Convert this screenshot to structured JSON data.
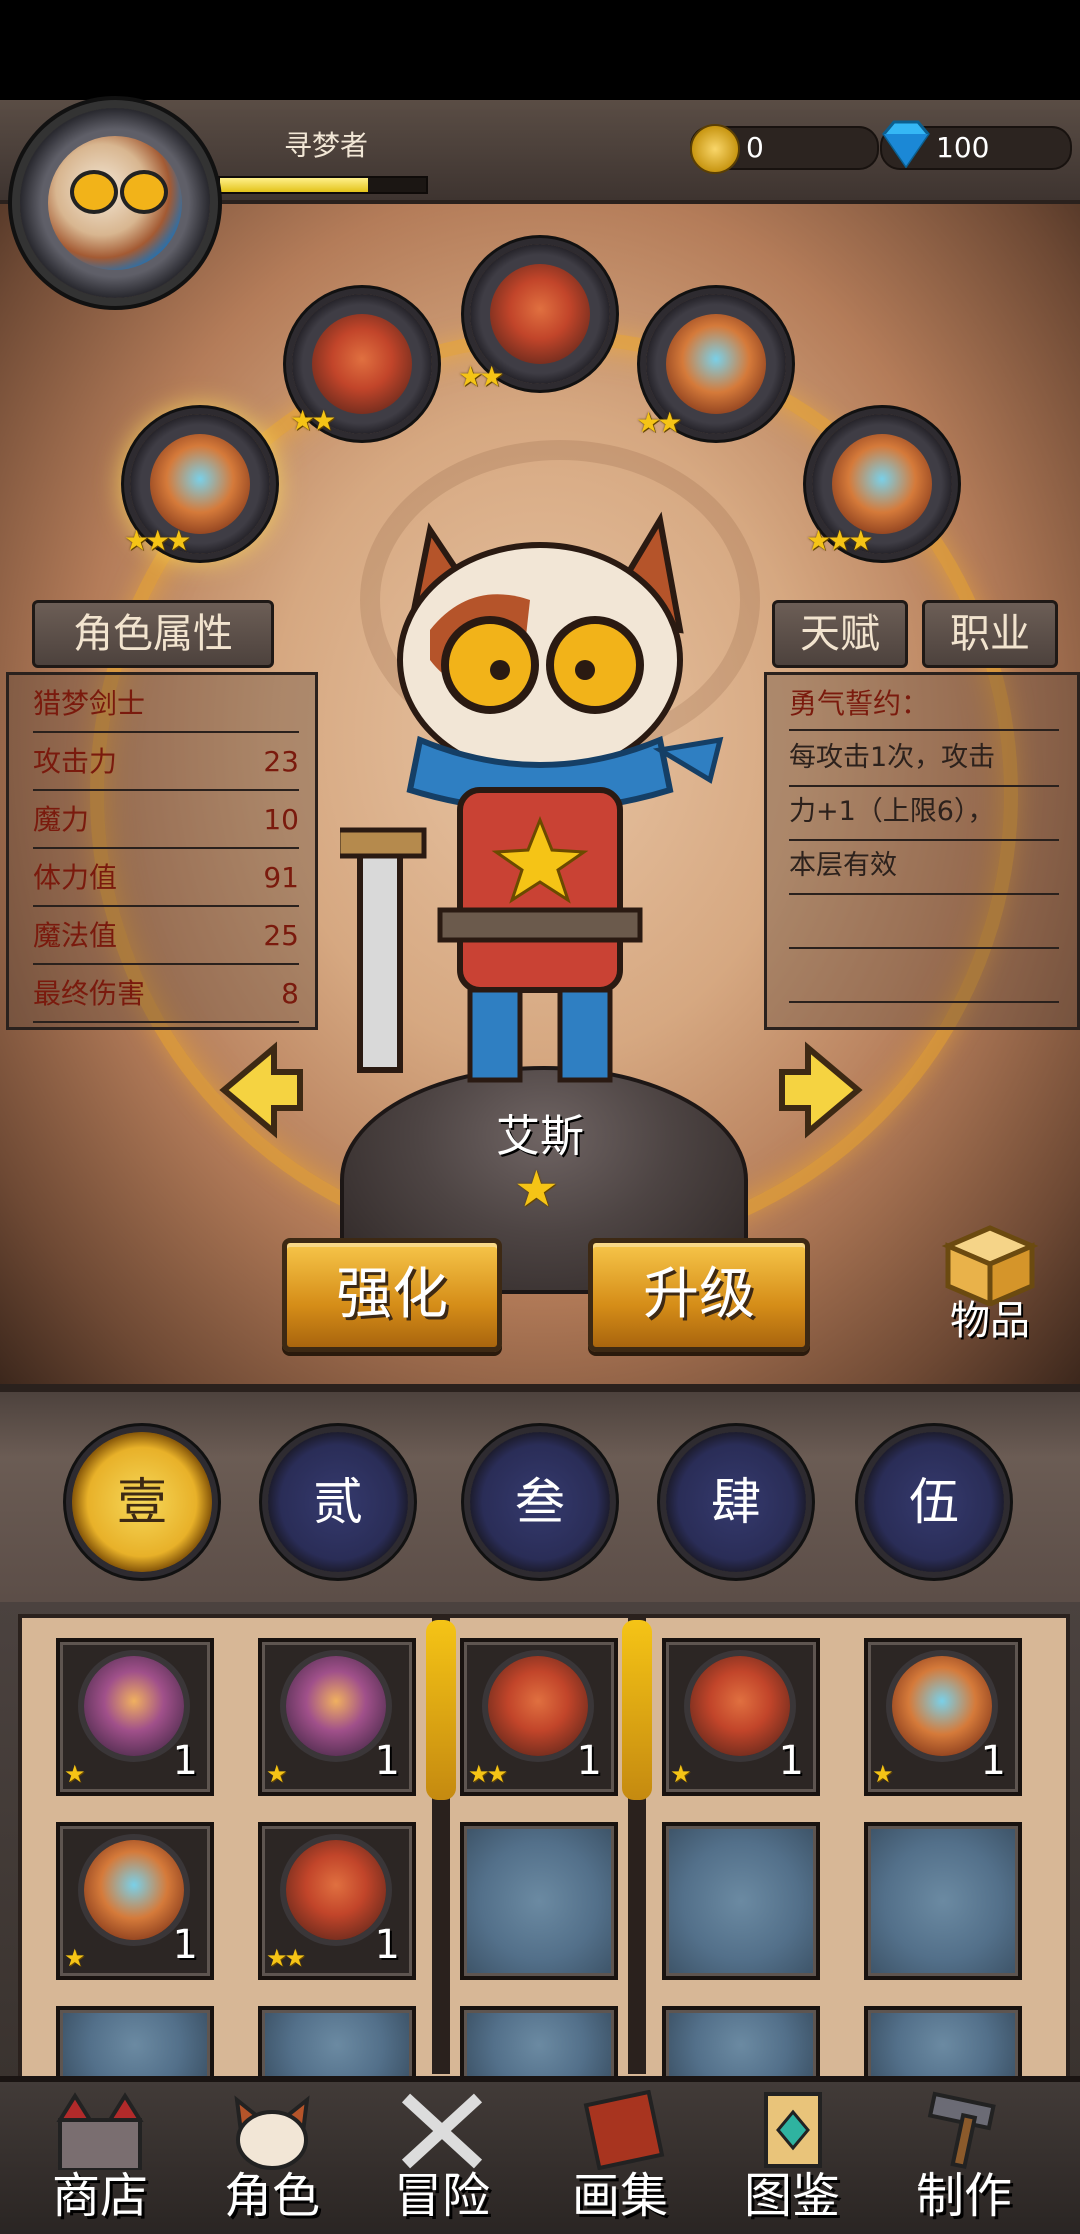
{
  "player": {
    "name": "寻梦者",
    "xp_fraction": 0.72
  },
  "currencies": {
    "gold": "0",
    "gems": "100"
  },
  "companions": [
    {
      "stars": "★★★",
      "kind": "blue"
    },
    {
      "stars": "★★",
      "kind": "red"
    },
    {
      "stars": "★★",
      "kind": "red"
    },
    {
      "stars": "★★",
      "kind": "blue"
    },
    {
      "stars": "★★★",
      "kind": "blue"
    }
  ],
  "tabs": {
    "attributes": "角色属性",
    "talent": "天赋",
    "class": "职业"
  },
  "stats": {
    "class_name": "猎梦剑士",
    "rows": [
      {
        "label": "攻击力",
        "value": "23"
      },
      {
        "label": "魔力",
        "value": "10"
      },
      {
        "label": "体力值",
        "value": "91"
      },
      {
        "label": "魔法值",
        "value": "25"
      },
      {
        "label": "最终伤害",
        "value": "8"
      }
    ]
  },
  "talent": {
    "title": "勇气誓约：",
    "desc_line1": "每攻击1次，攻击",
    "desc_line2": "力+1（上限6），",
    "desc_line3": "本层有效"
  },
  "hero": {
    "name": "艾斯",
    "stars": "★"
  },
  "buttons": {
    "enhance": "强化",
    "upgrade": "升级",
    "items": "物品"
  },
  "page_tabs": [
    "壹",
    "贰",
    "叁",
    "肆",
    "伍"
  ],
  "inventory": [
    {
      "kind": "purple",
      "stars": "★",
      "count": "1"
    },
    {
      "kind": "purple",
      "stars": "★",
      "count": "1"
    },
    {
      "kind": "red",
      "stars": "★★",
      "count": "1"
    },
    {
      "kind": "red",
      "stars": "★",
      "count": "1"
    },
    {
      "kind": "blue",
      "stars": "★",
      "count": "1"
    },
    {
      "kind": "blue",
      "stars": "★",
      "count": "1"
    },
    {
      "kind": "red",
      "stars": "★★",
      "count": "1"
    }
  ],
  "nav": [
    "商店",
    "角色",
    "冒险",
    "画集",
    "图鉴",
    "制作"
  ],
  "colors": {
    "accent_gold": "#f5c416",
    "stat_red": "#7a1a0d"
  }
}
